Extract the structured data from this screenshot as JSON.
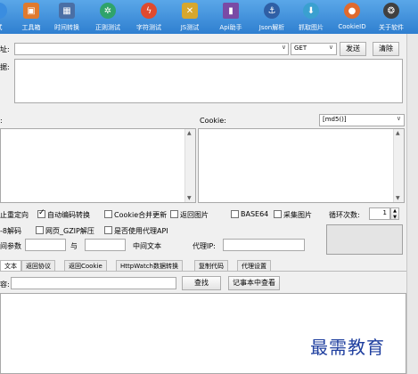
{
  "toolbar": {
    "items": [
      {
        "label": "试",
        "icon": "partial-icon",
        "color": "#3a8de0"
      },
      {
        "label": "工具箱",
        "icon": "toolbox-icon",
        "color": "#e07a2e"
      },
      {
        "label": "时间转换",
        "icon": "calendar-icon",
        "color": "#4a6fa5"
      },
      {
        "label": "正则测试",
        "icon": "gear-wheel-icon",
        "color": "#2fa36b"
      },
      {
        "label": "字符测试",
        "icon": "lightning-icon",
        "color": "#e04a2e"
      },
      {
        "label": "JS测试",
        "icon": "tools-icon",
        "color": "#d6a72e"
      },
      {
        "label": "Api助手",
        "icon": "book-icon",
        "color": "#7a4aa5"
      },
      {
        "label": "Json解析",
        "icon": "anchor-icon",
        "color": "#2f5fa5"
      },
      {
        "label": "抓取图片",
        "icon": "download-icon",
        "color": "#3aa0d0"
      },
      {
        "label": "CookieID",
        "icon": "cookie-icon",
        "color": "#e06a2e"
      },
      {
        "label": "关于软件",
        "icon": "aperture-icon",
        "color": "#404040"
      }
    ]
  },
  "request": {
    "url_label": "址:",
    "url_value": "",
    "method": "GET",
    "send_label": "发送",
    "clear_label": "清除",
    "data_label": "据:"
  },
  "headers": {
    "left_label": ":",
    "cookie_label": "Cookie:",
    "cookie_select": "[md5()]"
  },
  "options": {
    "redirect": "止重定向",
    "auto_encode": "自动编码转换",
    "auto_encode_checked": true,
    "cookie_merge": "Cookie合并更新",
    "return_image": "返回图片",
    "base64": "BASE64",
    "collect_image": "采集图片",
    "loop_label": "循环次数:",
    "loop_value": "1",
    "utf8_decode": "-8解码",
    "gzip": "网页_GZIP解压",
    "use_proxy": "是否使用代理API",
    "param_label": "间参数",
    "and_label": "与",
    "mid_text_label": "中间文本",
    "proxy_ip_label": "代理IP:"
  },
  "tabs": [
    "文本",
    "返回协议",
    "返回Cookie",
    "HttpWatch数据转换",
    "复制代码",
    "代理设置"
  ],
  "search": {
    "label": "容:",
    "find_label": "查找",
    "notepad_label": "记事本中查看"
  },
  "watermark": "最需教育"
}
